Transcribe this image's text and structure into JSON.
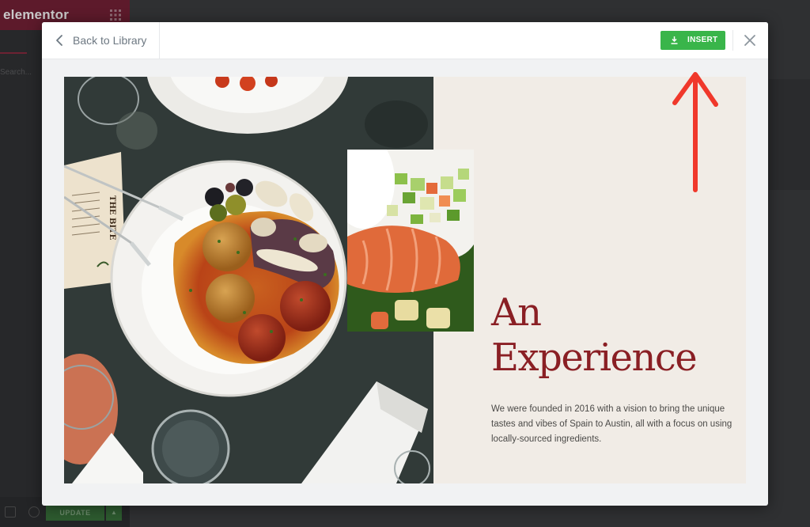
{
  "editor": {
    "logo": "elementor",
    "search_stub": "Search...",
    "update_label": "UPDATE",
    "update_caret": "▲",
    "grid_icon": "grid-icon"
  },
  "modal": {
    "back_label": "Back to Library",
    "back_icon": "chevron-left-icon",
    "insert_label": "INSERT",
    "insert_icon": "download-icon",
    "close_icon": "close-icon"
  },
  "template": {
    "headline_line1": "An",
    "headline_line2": "Experience",
    "body": "We were founded in 2016 with a vision to bring the unique tastes and vibes of Spain to Austin, all with a focus on using locally-sourced ingredients.",
    "menu_card_text": "THE BITE",
    "accent_color": "#8a1f24",
    "background_color": "#f1ece6"
  },
  "annotation": {
    "arrow_color": "#f0382b",
    "arrow_icon": "arrow-up-icon"
  },
  "colors": {
    "insert_green": "#39b54a",
    "editor_header": "#5d1a2b"
  }
}
